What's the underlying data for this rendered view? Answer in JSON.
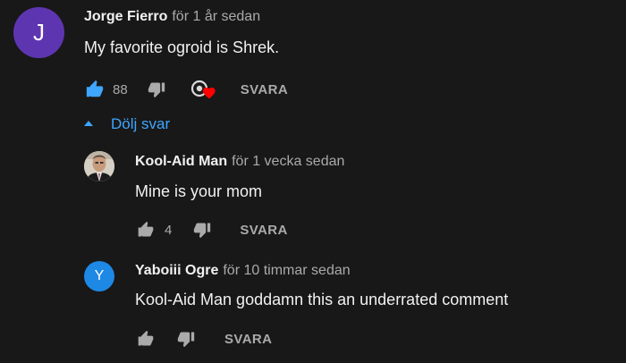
{
  "comment": {
    "avatar_letter": "J",
    "avatar_color": "#5e35b1",
    "author": "Jorge Fierro",
    "time": "för 1 år sedan",
    "text": "My favorite ogroid is Shrek.",
    "likes": "88",
    "like_active_color": "#3ea6ff",
    "hearted": true,
    "heart_color": "#ff0000",
    "reply_label": "SVARA"
  },
  "replies_toggle": {
    "label": "Dölj svar",
    "icon": "caret-up-icon"
  },
  "replies": [
    {
      "avatar_icon": "profile-photo",
      "author": "Kool-Aid Man",
      "time": "för 1 vecka sedan",
      "text": "Mine is your mom",
      "likes": "4",
      "reply_label": "SVARA"
    },
    {
      "avatar_letter": "Y",
      "avatar_color": "#1e88e5",
      "author": "Yaboiii Ogre",
      "time": "för 10 timmar sedan",
      "text": "Kool-Aid Man goddamn this an underrated comment",
      "likes": "",
      "reply_label": "SVARA"
    }
  ]
}
